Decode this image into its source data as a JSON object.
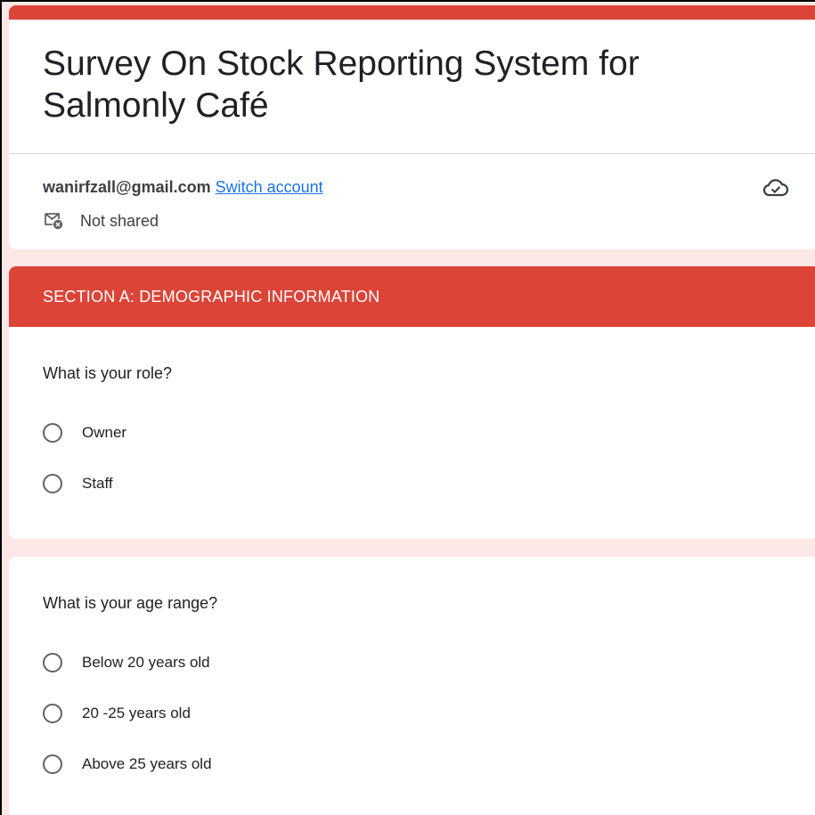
{
  "form": {
    "title": "Survey On Stock Reporting System for Salmonly Café",
    "accent_color": "#db4437",
    "background_color": "#fce8e6"
  },
  "account": {
    "email": "wanirfzall@gmail.com",
    "switch_label": "Switch account",
    "sharing_status": "Not shared",
    "save_icon": "cloud-check-icon",
    "sharing_icon": "mail-not-shared-icon"
  },
  "section": {
    "title": "SECTION A: DEMOGRAPHIC INFORMATION"
  },
  "questions": [
    {
      "text": "What is your role?",
      "options": [
        "Owner",
        "Staff"
      ]
    },
    {
      "text": "What is your age range?",
      "options": [
        "Below 20 years old",
        "20 -25 years old",
        "Above 25 years old"
      ]
    }
  ]
}
